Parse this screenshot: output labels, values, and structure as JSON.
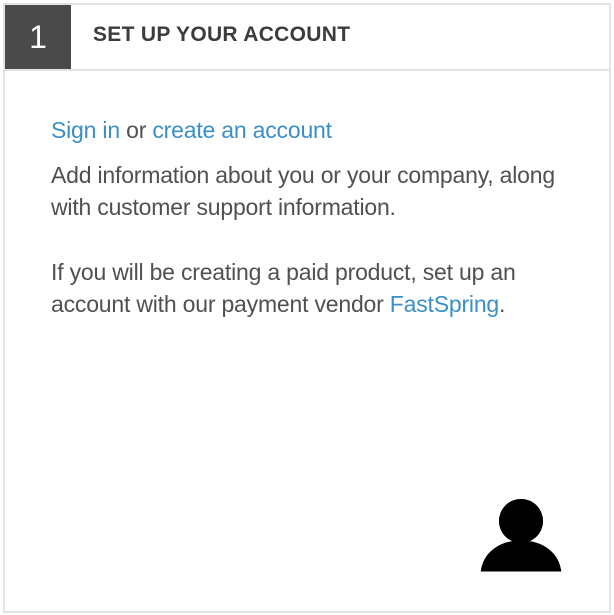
{
  "step": {
    "number": "1",
    "title": "SET UP YOUR ACCOUNT"
  },
  "signin": {
    "sign_in_link": "Sign in",
    "connector": " or ",
    "create_account_link": "create an account"
  },
  "paragraphs": {
    "info": "Add information about you or your company, along with customer support information.",
    "paid_prefix": "If you will be creating a paid product, set up an account with our payment vendor ",
    "vendor_link": "FastSpring",
    "paid_suffix": "."
  },
  "icons": {
    "account": "user-silhouette-icon"
  },
  "colors": {
    "link": "#3b8fc6",
    "badge_bg": "#4a4a4a",
    "text": "#505050",
    "border": "#e3e3e3"
  }
}
